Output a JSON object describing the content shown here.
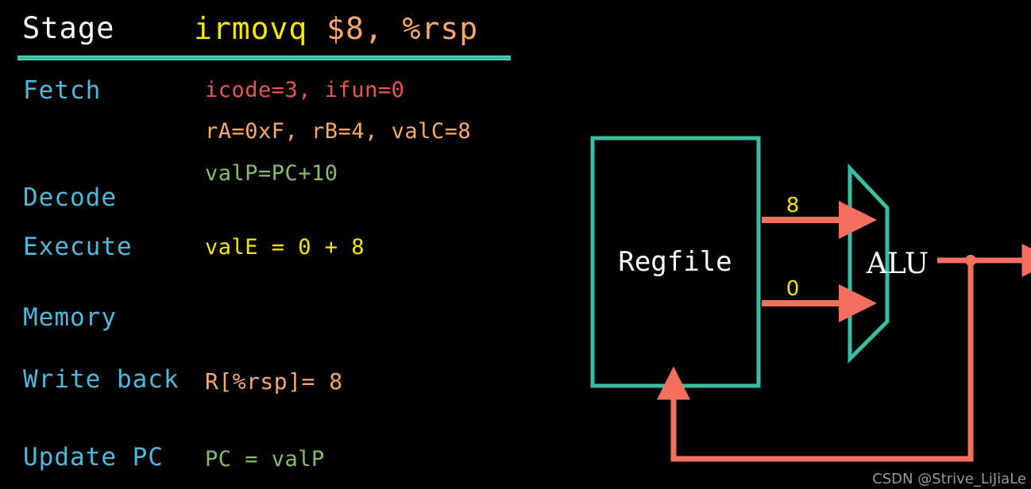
{
  "header": {
    "stage_col_label": "Stage",
    "instruction_op": "irmovq",
    "instruction_args": " $8, %rsp",
    "rule_color": "#37bfa6"
  },
  "colors": {
    "background": "#000000",
    "stage_label": "#4fb8dd",
    "teal": "#37bfa6",
    "salmon": "#f4705e",
    "yellow": "#f5e800",
    "orange": "#f6a96b",
    "red": "#e8554e",
    "green": "#86bd6a",
    "white": "#ffffff"
  },
  "stages": [
    {
      "label": "Fetch",
      "lines": [
        {
          "text": "icode=3, ifun=0",
          "color": "red"
        },
        {
          "text": "rA=0xF, rB=4, valC=8",
          "color": "orange"
        },
        {
          "text": "valP=PC+10",
          "color": "green"
        }
      ]
    },
    {
      "label": "Decode",
      "lines": []
    },
    {
      "label": "Execute",
      "lines": [
        {
          "text": "valE = 0 + 8",
          "color": "yellow"
        }
      ]
    },
    {
      "label": "Memory",
      "lines": []
    },
    {
      "label": "Write back",
      "lines": [
        {
          "text": "R[%rsp]= 8",
          "color": "orange"
        }
      ]
    },
    {
      "label": "Update PC",
      "lines": [
        {
          "text": "PC = valP",
          "color": "green"
        }
      ]
    }
  ],
  "diagram": {
    "regfile_label": "Regfile",
    "alu_label": "ALU",
    "operand_top": "8",
    "operand_bottom": "0"
  },
  "watermark": "CSDN @Strive_LiJiaLe"
}
